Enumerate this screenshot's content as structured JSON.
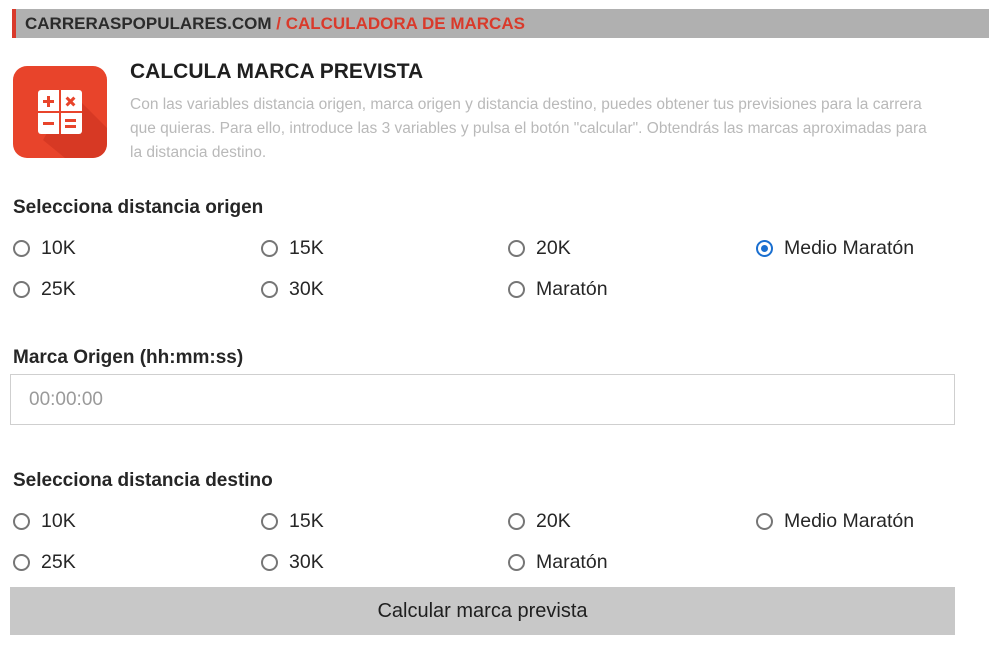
{
  "breadcrumb": {
    "site": "CARRERASPOPULARES.COM",
    "separator": " / ",
    "current": "CALCULADORA DE MARCAS"
  },
  "header": {
    "icon": "calculator-icon",
    "title": "CALCULA MARCA PREVISTA",
    "description": "Con las variables distancia origen, marca origen y distancia destino, puedes obtener tus previsiones para la carrera que quieras. Para ello, introduce las 3 variables y pulsa el botón \"calcular\". Obtendrás las marcas aproximadas para la distancia destino."
  },
  "origin": {
    "label": "Selecciona distancia origen",
    "options": [
      "10K",
      "15K",
      "20K",
      "Medio Maratón",
      "25K",
      "30K",
      "Maratón"
    ],
    "selected": "Medio Maratón"
  },
  "time": {
    "label": "Marca Origen (hh:mm:ss)",
    "value": "",
    "placeholder": "00:00:00"
  },
  "destination": {
    "label": "Selecciona distancia destino",
    "options": [
      "10K",
      "15K",
      "20K",
      "Medio Maratón",
      "25K",
      "30K",
      "Maratón"
    ],
    "selected": ""
  },
  "submit": {
    "label": "Calcular marca prevista"
  },
  "colors": {
    "accent": "#d93a2b",
    "icon_bg": "#e8442b",
    "radio_selected": "#1a6fd0",
    "bar_bg": "#b0b0b0",
    "button_bg": "#c8c8c8"
  }
}
